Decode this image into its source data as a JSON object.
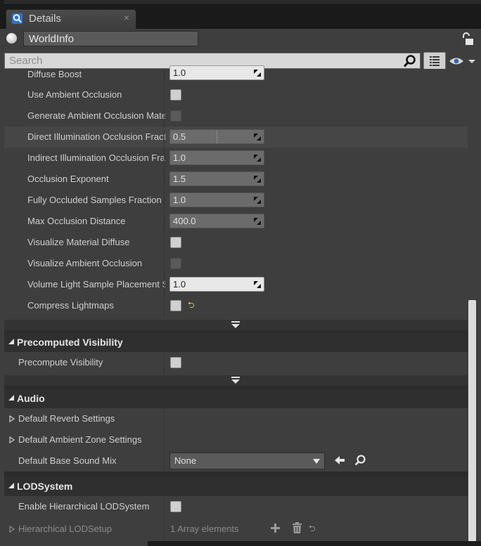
{
  "tab": {
    "title": "Details",
    "close": "×",
    "icon": "details-icon"
  },
  "object": {
    "name": "WorldInfo"
  },
  "search": {
    "placeholder": "Search"
  },
  "lightmass_rows": [
    {
      "label": "Diffuse Boost",
      "type": "number",
      "value": "1.0"
    },
    {
      "label": "Use Ambient Occlusion",
      "type": "checkbox",
      "checked": false
    },
    {
      "label": "Generate Ambient Occlusion Material Mask",
      "type": "checkbox",
      "checked": false,
      "disabled": true
    },
    {
      "label": "Direct Illumination Occlusion Fraction",
      "type": "number",
      "value": "0.5"
    },
    {
      "label": "Indirect Illumination Occlusion Fraction",
      "type": "number",
      "value": "1.0"
    },
    {
      "label": "Occlusion Exponent",
      "type": "number",
      "value": "1.5"
    },
    {
      "label": "Fully Occluded Samples Fraction",
      "type": "number",
      "value": "1.0"
    },
    {
      "label": "Max Occlusion Distance",
      "type": "number",
      "value": "400.0"
    },
    {
      "label": "Visualize Material Diffuse",
      "type": "checkbox",
      "checked": false
    },
    {
      "label": "Visualize Ambient Occlusion",
      "type": "checkbox",
      "checked": false,
      "disabled": true
    },
    {
      "label": "Volume Light Sample Placement Scale",
      "type": "number",
      "value": "1.0"
    },
    {
      "label": "Compress Lightmaps",
      "type": "checkbox",
      "checked": false,
      "reset": "⮌"
    }
  ],
  "precomputed_visibility": {
    "title": "Precomputed Visibility",
    "rows": [
      {
        "label": "Precompute Visibility",
        "type": "checkbox",
        "checked": false
      }
    ]
  },
  "audio": {
    "title": "Audio",
    "default_reverb": "Default Reverb Settings",
    "default_ambient_zone": "Default Ambient Zone Settings",
    "base_sound_mix": {
      "label": "Default Base Sound Mix",
      "value": "None"
    }
  },
  "lod_system": {
    "title": "LODSystem",
    "enable_label": "Enable Hierarchical LODSystem",
    "setup": {
      "label": "Hierarchical LODSetup",
      "info": "1 Array elements",
      "reset": "⮌"
    }
  },
  "colors": {
    "panel": "#3e3e3e",
    "category": "#2f2f2f",
    "reset_arrow": "#f0d23c"
  }
}
